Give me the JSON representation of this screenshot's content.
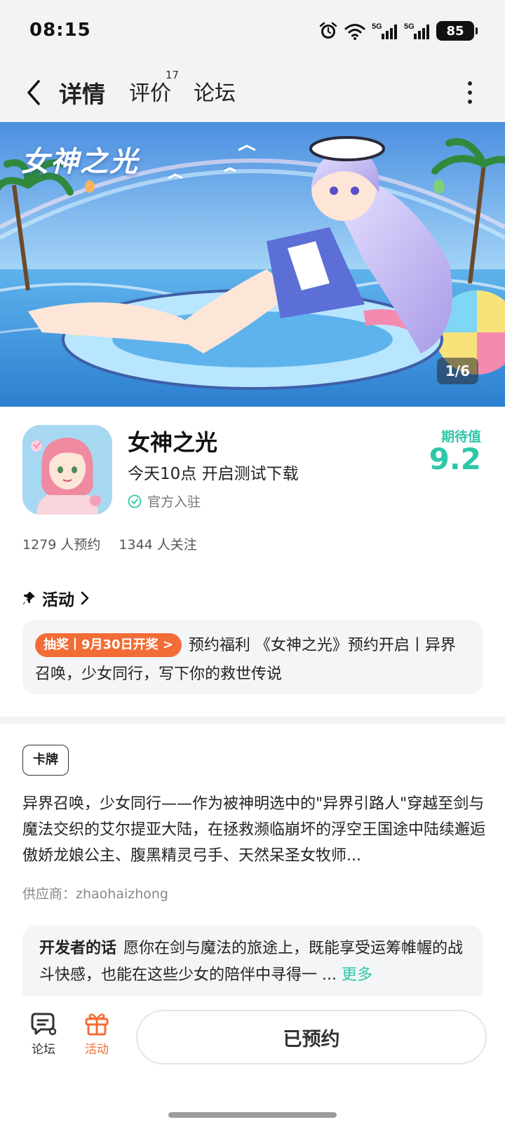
{
  "status_bar": {
    "time": "08:15",
    "battery": "85",
    "icons": [
      "alarm-icon",
      "wifi-icon",
      "signal-5g-icon",
      "signal-5g-icon",
      "battery-icon"
    ]
  },
  "nav": {
    "tabs": [
      {
        "label": "详情",
        "active": true
      },
      {
        "label": "评价",
        "badge": "17"
      },
      {
        "label": "论坛"
      }
    ]
  },
  "banner": {
    "title": "女神之光",
    "counter": "1/6"
  },
  "app": {
    "name": "女神之光",
    "subtitle": "今天10点 开启测试下载",
    "verified_label": "官方入驻",
    "expect_label": "期待值",
    "expect_score": "9.2",
    "reservations": "1279 人预约",
    "followers": "1344 人关注"
  },
  "activity": {
    "header": "活动",
    "badge": "抽奖丨9月30日开奖 >",
    "text": "预约福利 《女神之光》预约开启丨异界召唤，少女同行，写下你的救世传说"
  },
  "details": {
    "tag": "卡牌",
    "description": "异界召唤，少女同行——作为被神明选中的\"异界引路人\"穿越至剑与魔法交织的艾尔提亚大陆，在拯救濒临崩坏的浮空王国途中陆续邂逅傲娇龙娘公主、腹黑精灵弓手、天然呆圣女牧师...",
    "supplier": "供应商：zhaohaizhong"
  },
  "developer": {
    "label": "开发者的话",
    "text": "愿你在剑与魔法的旅途上，既能享受运筹帷幄的战斗快感，也能在这些少女的陪伴中寻得一 ...",
    "more": "更多"
  },
  "bottom": {
    "forum_label": "论坛",
    "activity_label": "活动",
    "reserved_label": "已预约"
  },
  "colors": {
    "accent": "#2ec7a8",
    "orange": "#f26d36"
  }
}
